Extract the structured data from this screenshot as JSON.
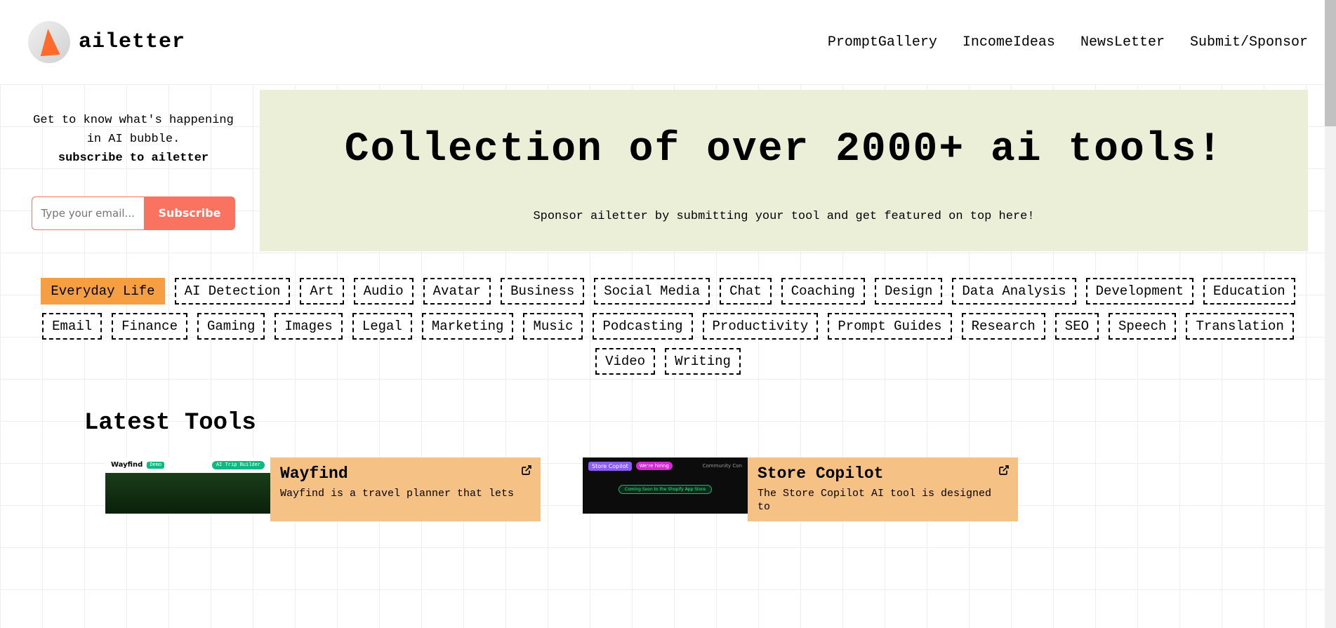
{
  "brand": "ailetter",
  "nav": {
    "prompt": "PromptGallery",
    "income": "IncomeIdeas",
    "newsletter": "NewsLetter",
    "submit": "Submit/Sponsor"
  },
  "sidebar": {
    "line1": "Get to know what's happening in AI bubble.",
    "line2": "subscribe to ailetter",
    "email_placeholder": "Type your email...",
    "subscribe": "Subscribe"
  },
  "hero": {
    "title": "Collection of over 2000+ ai tools!",
    "subtitle": "Sponsor ailetter by submitting your tool and get featured on top here!"
  },
  "categories": {
    "active": "Everyday Life",
    "list": [
      "AI Detection",
      "Art",
      "Audio",
      "Avatar",
      "Business",
      "Social Media",
      "Chat",
      "Coaching",
      "Design",
      "Data Analysis",
      "Development",
      "Education",
      "Email",
      "Finance",
      "Gaming",
      "Images",
      "Legal",
      "Marketing",
      "Music",
      "Podcasting",
      "Productivity",
      "Prompt Guides",
      "Research",
      "SEO",
      "Speech",
      "Translation",
      "Video",
      "Writing"
    ]
  },
  "latest_heading": "Latest Tools",
  "tools": [
    {
      "name": "Wayfind",
      "desc": "Wayfind is a travel planner that lets",
      "thumb": {
        "label": "Wayfind",
        "badge": "Demo",
        "btn": "AI Trip Builder"
      }
    },
    {
      "name": "Store Copilot",
      "desc": "The Store Copilot AI tool is designed to",
      "thumb": {
        "logo": "Store Copilot",
        "badge": "We're hiring",
        "right": "Community  Con",
        "pill": "Coming Soon to the Shopify App Store"
      }
    }
  ]
}
